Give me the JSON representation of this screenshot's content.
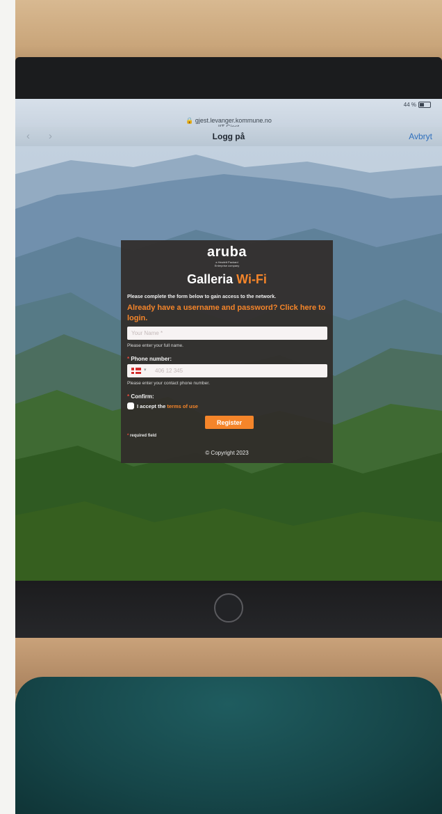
{
  "browser": {
    "url": "gjest.levanger.kommune.no",
    "ssid": "IIT-Gjest",
    "battery": "44 %",
    "title": "Logg på",
    "cancel_label": "Avbryt",
    "back_icon": "chevron-left-icon",
    "forward_icon": "chevron-right-icon"
  },
  "portal": {
    "logo": "aruba",
    "logo_sub_1": "a Hewlett Packard",
    "logo_sub_2": "Enterprise company",
    "heading_main": "Galleria ",
    "heading_accent": "Wi-Fi",
    "intro": "Please complete the form below to gain access to the network.",
    "login_link": "Already have a username and password? Click here to login.",
    "name_placeholder": "Your Name *",
    "name_hint": "Please enter your full name.",
    "phone_label": "Phone number:",
    "phone_placeholder": "406 12 345",
    "phone_hint": "Please enter your contact phone number.",
    "confirm_label": "Confirm:",
    "accept_text": "I accept the ",
    "terms_link": "terms of use",
    "register_label": "Register",
    "required_note": "required field",
    "copyright": "© Copyright 2023"
  },
  "colors": {
    "accent": "#f5852a",
    "panel": "#302c2a",
    "ios_link": "#2f6fbd"
  }
}
